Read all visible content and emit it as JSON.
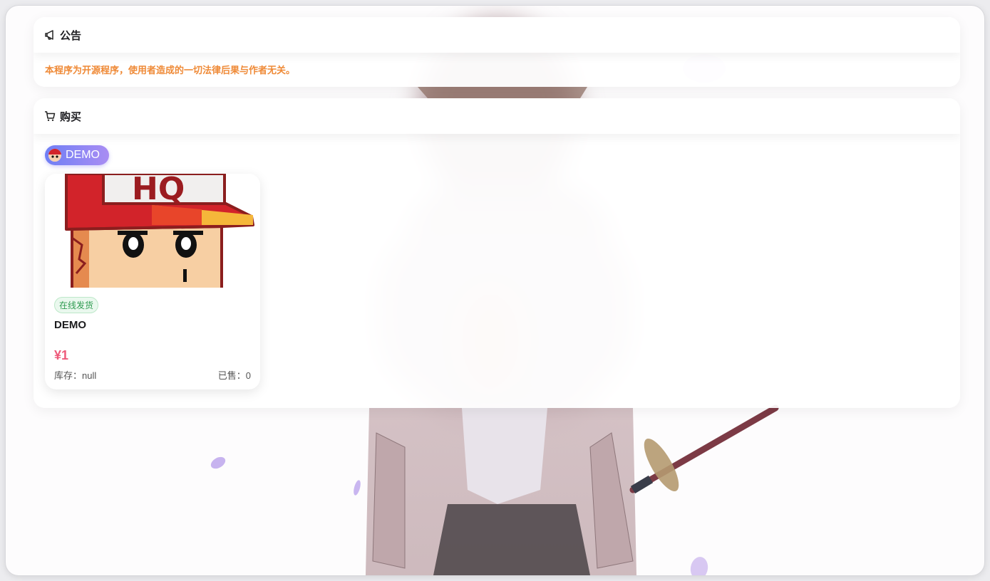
{
  "notice": {
    "title": "公告",
    "icon": "megaphone-icon",
    "text": "本程序为开源程序，使用者造成的一切法律后果与作者无关。"
  },
  "buy": {
    "title": "购买",
    "icon": "cart-icon",
    "category_label": "DEMO",
    "product": {
      "image_text": "HQ",
      "shipping_tag": "在线发货",
      "name": "DEMO",
      "price": "¥1",
      "stock": "库存：null",
      "sold": "已售：0"
    }
  },
  "colors": {
    "accent_orange": "#ef8a37",
    "price_pink": "#ee5a7a",
    "tag_gradient_start": "#6f7ff5",
    "tag_gradient_end": "#a98df3",
    "ship_green": "#2d9a4f"
  }
}
